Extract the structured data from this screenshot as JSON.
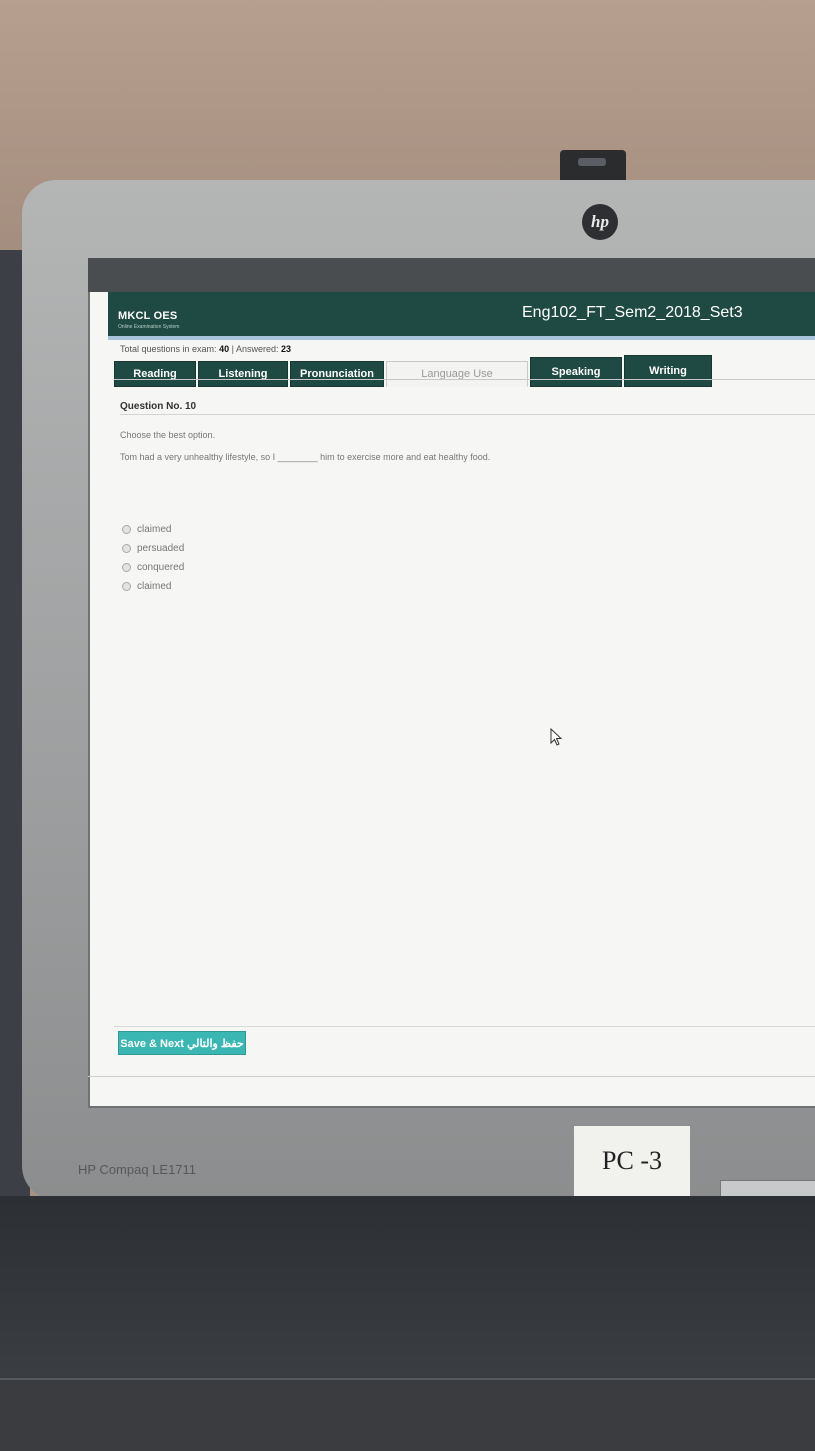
{
  "exam": {
    "system_name": "MKCL OES",
    "system_subtitle": "Online Examination System",
    "title": "Eng102_FT_Sem2_2018_Set3"
  },
  "stats": {
    "total_label": "Total questions in exam:",
    "total_value": "40",
    "answered_label": "| Answered:",
    "answered_value": "23"
  },
  "tabs": [
    {
      "label": "Reading"
    },
    {
      "label": "Listening"
    },
    {
      "label": "Pronunciation"
    },
    {
      "label": "Language Use"
    },
    {
      "label": "Speaking"
    },
    {
      "label": "Writing"
    }
  ],
  "active_tab": "Language Use",
  "question": {
    "number_label": "Question No. 10",
    "instruction": "Choose the best option.",
    "stem": "Tom had a very unhealthy lifestyle, so I ________ him to exercise more and eat healthy food.",
    "options": [
      "claimed",
      "persuaded",
      "conquered",
      "claimed"
    ]
  },
  "actions": {
    "save_next": "Save & Next حفظ والتالي"
  },
  "monitor": {
    "brand_logo": "hp",
    "model": "HP Compaq LE1711",
    "pc_label": "PC -3"
  },
  "colors": {
    "header": "#1f4a43",
    "accent_button": "#3ab7b2"
  }
}
